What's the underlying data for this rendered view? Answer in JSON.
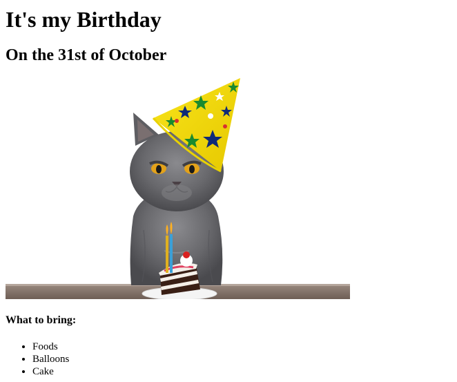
{
  "page": {
    "title": "It's my Birthday",
    "subtitle": "On the 31st of October",
    "image": {
      "icon": "birthday-cat-photo"
    },
    "list_heading": "What to bring:",
    "list_items": [
      "Foods",
      "Balloons",
      "Cake"
    ]
  },
  "colors": {
    "hat_yellow": "#f5dd10",
    "cat_grey": "#6b6b6f",
    "table_brown": "#8a7a70"
  }
}
